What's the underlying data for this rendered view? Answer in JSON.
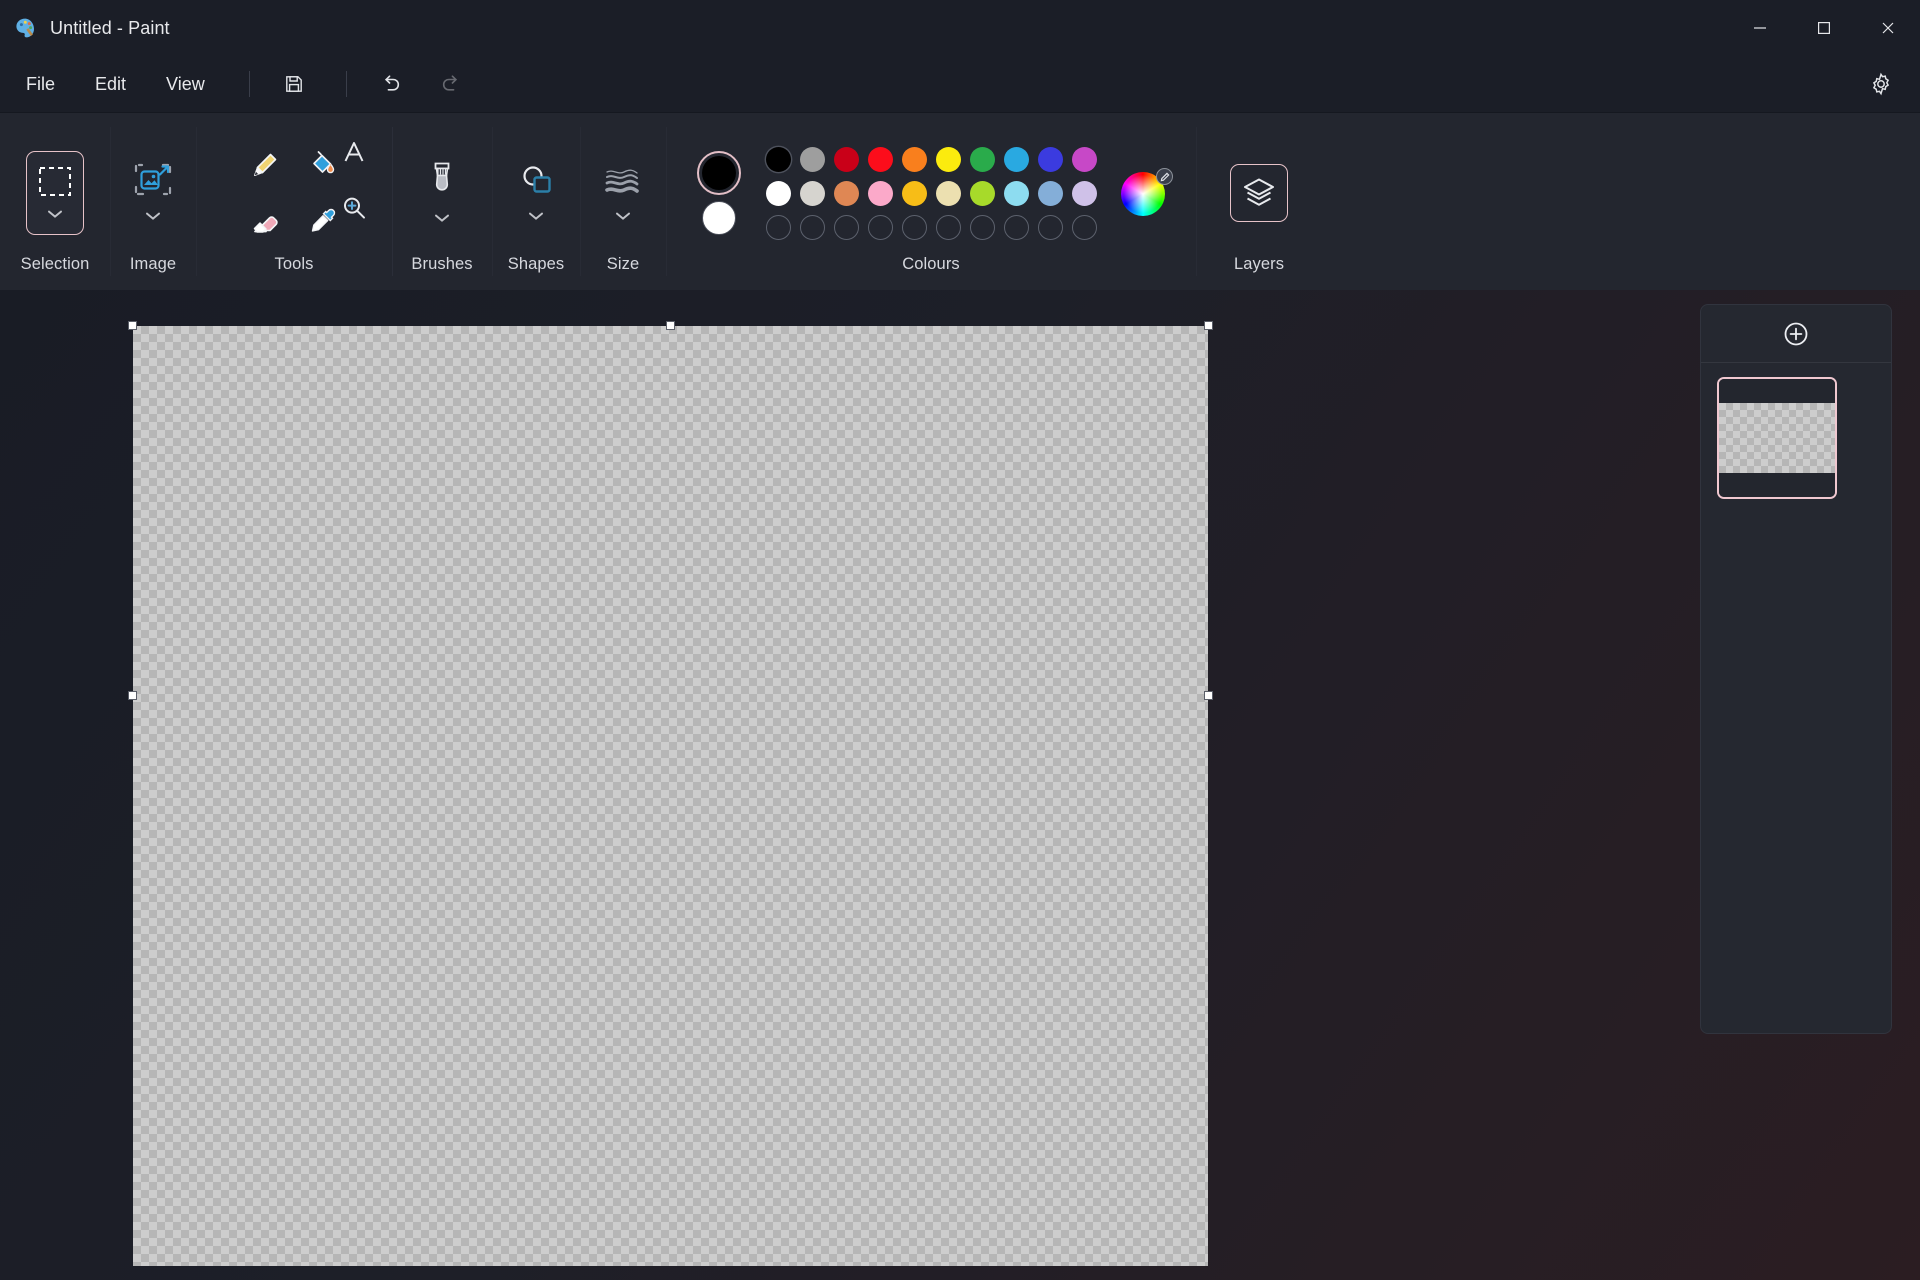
{
  "window": {
    "title": "Untitled - Paint",
    "app_icon": "paint-palette-icon",
    "minimize_label": "Minimize",
    "maximize_label": "Maximize",
    "close_label": "Close"
  },
  "menubar": {
    "items": [
      {
        "label": "File"
      },
      {
        "label": "Edit"
      },
      {
        "label": "View"
      }
    ],
    "tools": [
      {
        "icon": "save-icon",
        "label": "Save"
      },
      {
        "icon": "undo-icon",
        "label": "Undo"
      },
      {
        "icon": "redo-icon",
        "label": "Redo"
      }
    ],
    "settings_label": "Settings"
  },
  "ribbon": {
    "groups": [
      {
        "label": "Selection",
        "icon": "rectangular-selection-icon",
        "active": true
      },
      {
        "label": "Image",
        "icon": "resize-image-icon",
        "active": false
      },
      {
        "label": "Tools",
        "icon": "tools-group-icon",
        "active": false
      },
      {
        "label": "Brushes",
        "icon": "brush-icon",
        "active": false
      },
      {
        "label": "Shapes",
        "icon": "shapes-icon",
        "active": false
      },
      {
        "label": "Size",
        "icon": "size-lines-icon",
        "active": false
      },
      {
        "label": "Colours",
        "icon": "colours-icon",
        "active": false
      },
      {
        "label": "Layers",
        "icon": "layers-icon",
        "active": false
      }
    ],
    "tools": [
      {
        "name": "pencil-icon",
        "label": "Pencil"
      },
      {
        "name": "fill-bucket-icon",
        "label": "Fill with colour"
      },
      {
        "name": "text-icon",
        "label": "Text"
      },
      {
        "name": "eraser-icon",
        "label": "Eraser"
      },
      {
        "name": "eyedropper-icon",
        "label": "Colour picker"
      },
      {
        "name": "magnifier-icon",
        "label": "Magnifier"
      }
    ]
  },
  "colours": {
    "primary": "#000000",
    "secondary": "#ffffff",
    "row1": [
      "#000000",
      "#9e9e9e",
      "#c90018",
      "#fc0d1b",
      "#f97f1d",
      "#fbeb0e",
      "#2aab4b",
      "#29a9e1",
      "#3b3bdf",
      "#c748c7"
    ],
    "row2": [
      "#ffffff",
      "#d6d4cf",
      "#df8754",
      "#fba9c9",
      "#f7bd17",
      "#ece0b0",
      "#a7da2a",
      "#8ddcf0",
      "#84aed8",
      "#cfc1e8"
    ],
    "row3_empty_count": 10,
    "wheel_label": "Edit colours",
    "wheel_icon": "colour-wheel-icon",
    "wheel_edit_icon": "pencil-edit-icon"
  },
  "canvas": {
    "fill": "transparent-checkerboard",
    "handles": [
      "top-left",
      "top-center",
      "top-right",
      "middle-left",
      "middle-right"
    ]
  },
  "layers_panel": {
    "add_button_icon": "add-layer-plus-icon",
    "add_button_label": "Add new layer",
    "layers": [
      {
        "name": "layer-1",
        "selected": true,
        "thumbnail": "transparent-checkerboard"
      }
    ]
  }
}
